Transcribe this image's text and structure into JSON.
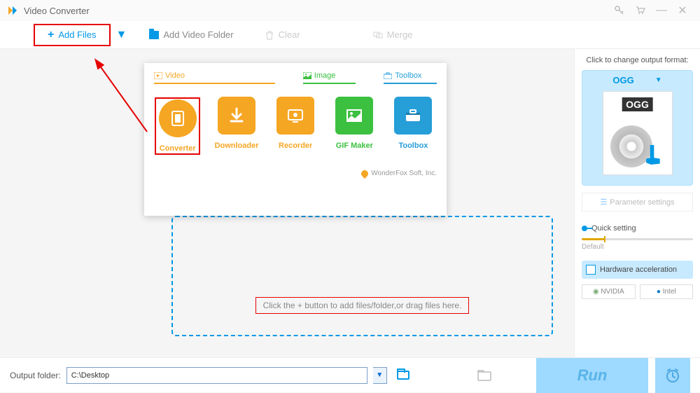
{
  "titlebar": {
    "title": "Video Converter"
  },
  "toolbar": {
    "add_files": "Add Files",
    "add_folder": "Add Video Folder",
    "clear": "Clear",
    "merge": "Merge"
  },
  "modules": {
    "tabs": {
      "video": "Video",
      "image": "Image",
      "toolbox": "Toolbox"
    },
    "converter": "Converter",
    "downloader": "Downloader",
    "recorder": "Recorder",
    "gif": "GIF Maker",
    "toolbox": "Toolbox",
    "brand": "WonderFox Soft, Inc."
  },
  "drop_hint": "Click the + button to add files/folder,or drag files here.",
  "side": {
    "format_label": "Click to change output format:",
    "format": "OGG",
    "format_badge": "OGG",
    "param": "Parameter settings",
    "quick": "Quick setting",
    "default": "Default",
    "hw": "Hardware acceleration",
    "nvidia": "NVIDIA",
    "intel": "Intel"
  },
  "footer": {
    "label": "Output folder:",
    "path": "C:\\Desktop",
    "run": "Run"
  }
}
